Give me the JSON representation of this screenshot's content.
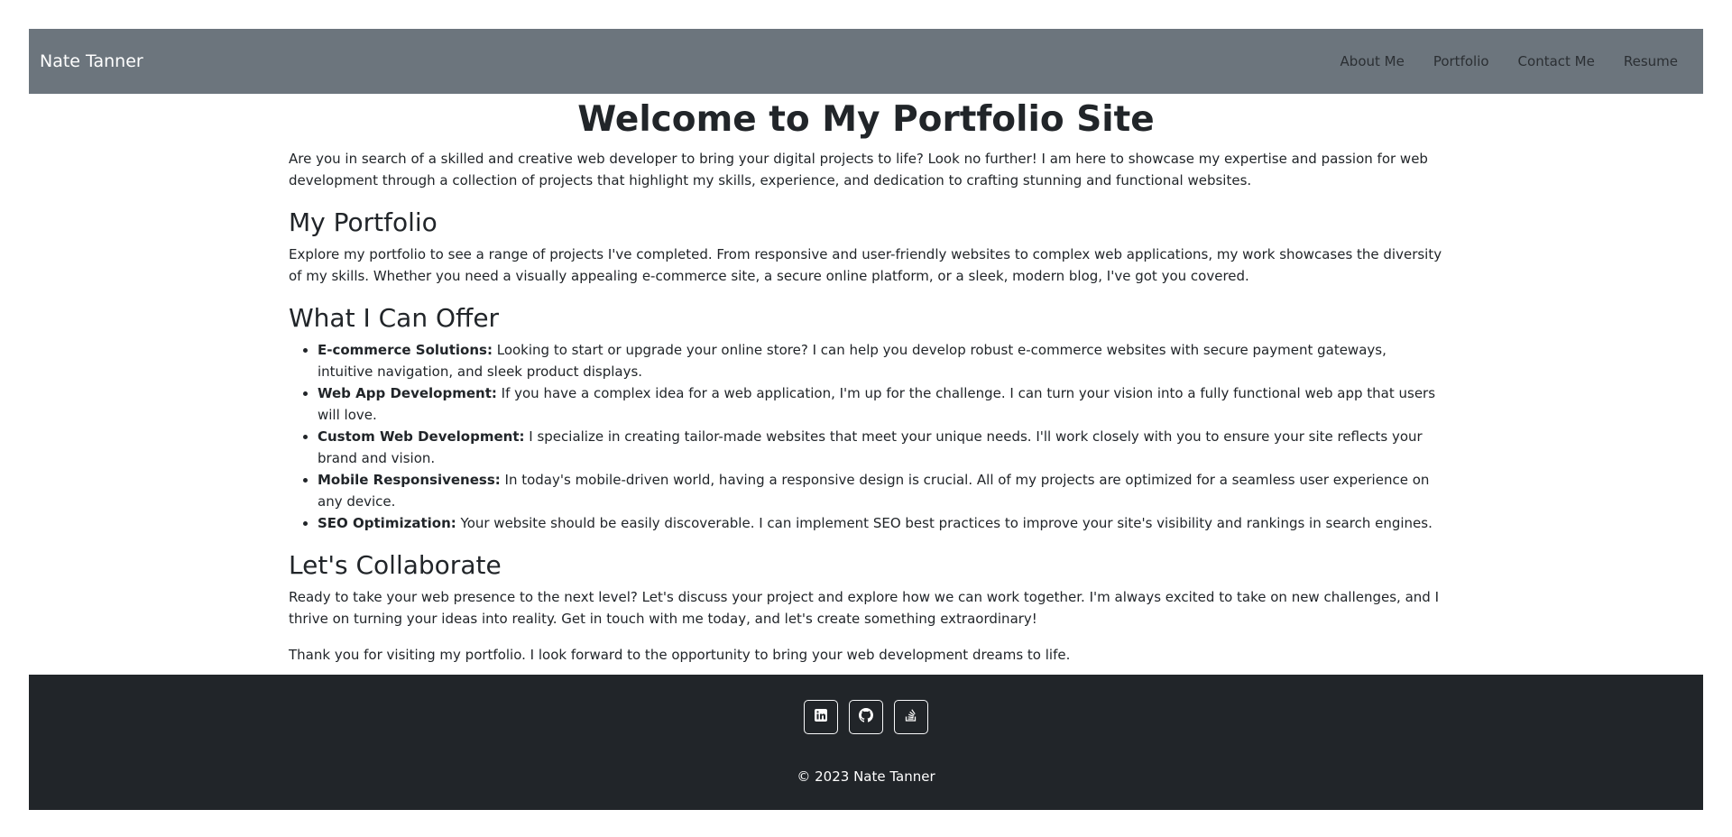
{
  "navbar": {
    "brand": "Nate Tanner",
    "links": [
      "About Me",
      "Portfolio",
      "Contact Me",
      "Resume"
    ]
  },
  "main": {
    "title": "Welcome to My Portfolio Site",
    "intro": "Are you in search of a skilled and creative web developer to bring your digital projects to life? Look no further! I am here to showcase my expertise and passion for web development through a collection of projects that highlight my skills, experience, and dedication to crafting stunning and functional websites.",
    "portfolio": {
      "heading": "My Portfolio",
      "text": "Explore my portfolio to see a range of projects I've completed. From responsive and user-friendly websites to complex web applications, my work showcases the diversity of my skills. Whether you need a visually appealing e-commerce site, a secure online platform, or a sleek, modern blog, I've got you covered."
    },
    "offer": {
      "heading": "What I Can Offer",
      "items": [
        {
          "term": "E-commerce Solutions:",
          "text": " Looking to start or upgrade your online store? I can help you develop robust e-commerce websites with secure payment gateways, intuitive navigation, and sleek product displays."
        },
        {
          "term": "Web App Development:",
          "text": " If you have a complex idea for a web application, I'm up for the challenge. I can turn your vision into a fully functional web app that users will love."
        },
        {
          "term": "Custom Web Development:",
          "text": " I specialize in creating tailor-made websites that meet your unique needs. I'll work closely with you to ensure your site reflects your brand and vision."
        },
        {
          "term": "Mobile Responsiveness:",
          "text": " In today's mobile-driven world, having a responsive design is crucial. All of my projects are optimized for a seamless user experience on any device."
        },
        {
          "term": "SEO Optimization:",
          "text": " Your website should be easily discoverable. I can implement SEO best practices to improve your site's visibility and rankings in search engines."
        }
      ]
    },
    "collaborate": {
      "heading": "Let's Collaborate",
      "text": "Ready to take your web presence to the next level? Let's discuss your project and explore how we can work together. I'm always excited to take on new challenges, and I thrive on turning your ideas into reality. Get in touch with me today, and let's create something extraordinary!"
    },
    "thanks": "Thank you for visiting my portfolio. I look forward to the opportunity to bring your web development dreams to life."
  },
  "footer": {
    "social": [
      "linkedin-icon",
      "github-icon",
      "stack-overflow-icon"
    ],
    "copyright": "© 2023 Nate Tanner"
  },
  "colors": {
    "navbar_bg": "#6c757d",
    "footer_bg": "#212529",
    "text": "#212529"
  }
}
